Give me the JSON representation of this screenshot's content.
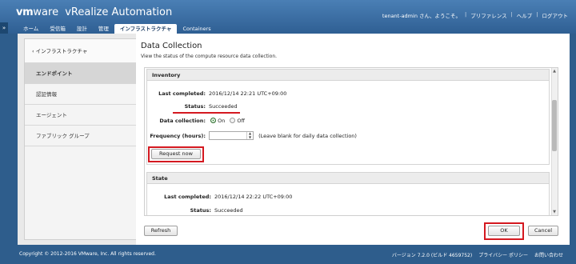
{
  "header": {
    "brand_vm": "vm",
    "brand_ware": "ware",
    "brand_product": "vRealize Automation",
    "user": "tenant-admin さん、ようこそ。",
    "links": [
      "プリファレンス",
      "ヘルプ",
      "ログアウト"
    ]
  },
  "tabs": [
    {
      "label": "ホーム"
    },
    {
      "label": "受信箱"
    },
    {
      "label": "設計"
    },
    {
      "label": "管理"
    },
    {
      "label": "インフラストラクチャ"
    },
    {
      "label": "Containers"
    }
  ],
  "sidebar": {
    "back_label": "‹ インフラストラクチャ",
    "items": [
      {
        "label": "エンドポイント"
      },
      {
        "label": "認証情報"
      },
      {
        "label": "エージェント"
      },
      {
        "label": "ファブリック グループ"
      }
    ]
  },
  "main": {
    "title": "Data Collection",
    "subtitle": "View the status of the compute resource data collection."
  },
  "inventory": {
    "heading": "Inventory",
    "last_completed_label": "Last completed:",
    "last_completed_value": "2016/12/14 22:21 UTC+09:00",
    "status_label": "Status:",
    "status_value": "Succeeded",
    "data_collection_label": "Data collection:",
    "on_label": "On",
    "off_label": "Off",
    "frequency_label": "Frequency (hours):",
    "frequency_value": "",
    "frequency_hint": "(Leave blank for daily data collection)",
    "request_button": "Request now"
  },
  "state": {
    "heading": "State",
    "last_completed_label": "Last completed:",
    "last_completed_value": "2016/12/14 22:22 UTC+09:00",
    "status_label": "Status:",
    "status_value": "Succeeded"
  },
  "buttons": {
    "refresh": "Refresh",
    "ok": "OK",
    "cancel": "Cancel"
  },
  "footer": {
    "copyright": "Copyright © 2012-2016 VMware, Inc. All rights reserved.",
    "version": "バージョン 7.2.0 (ビルド 4659752)",
    "privacy": "プライバシー ポリシー",
    "contact": "お問い合わせ"
  },
  "colors": {
    "header_top": "#4a7fb5",
    "header_bottom": "#2f5f93",
    "highlight_red": "#d41920",
    "radio_on": "#3a8f3a"
  }
}
